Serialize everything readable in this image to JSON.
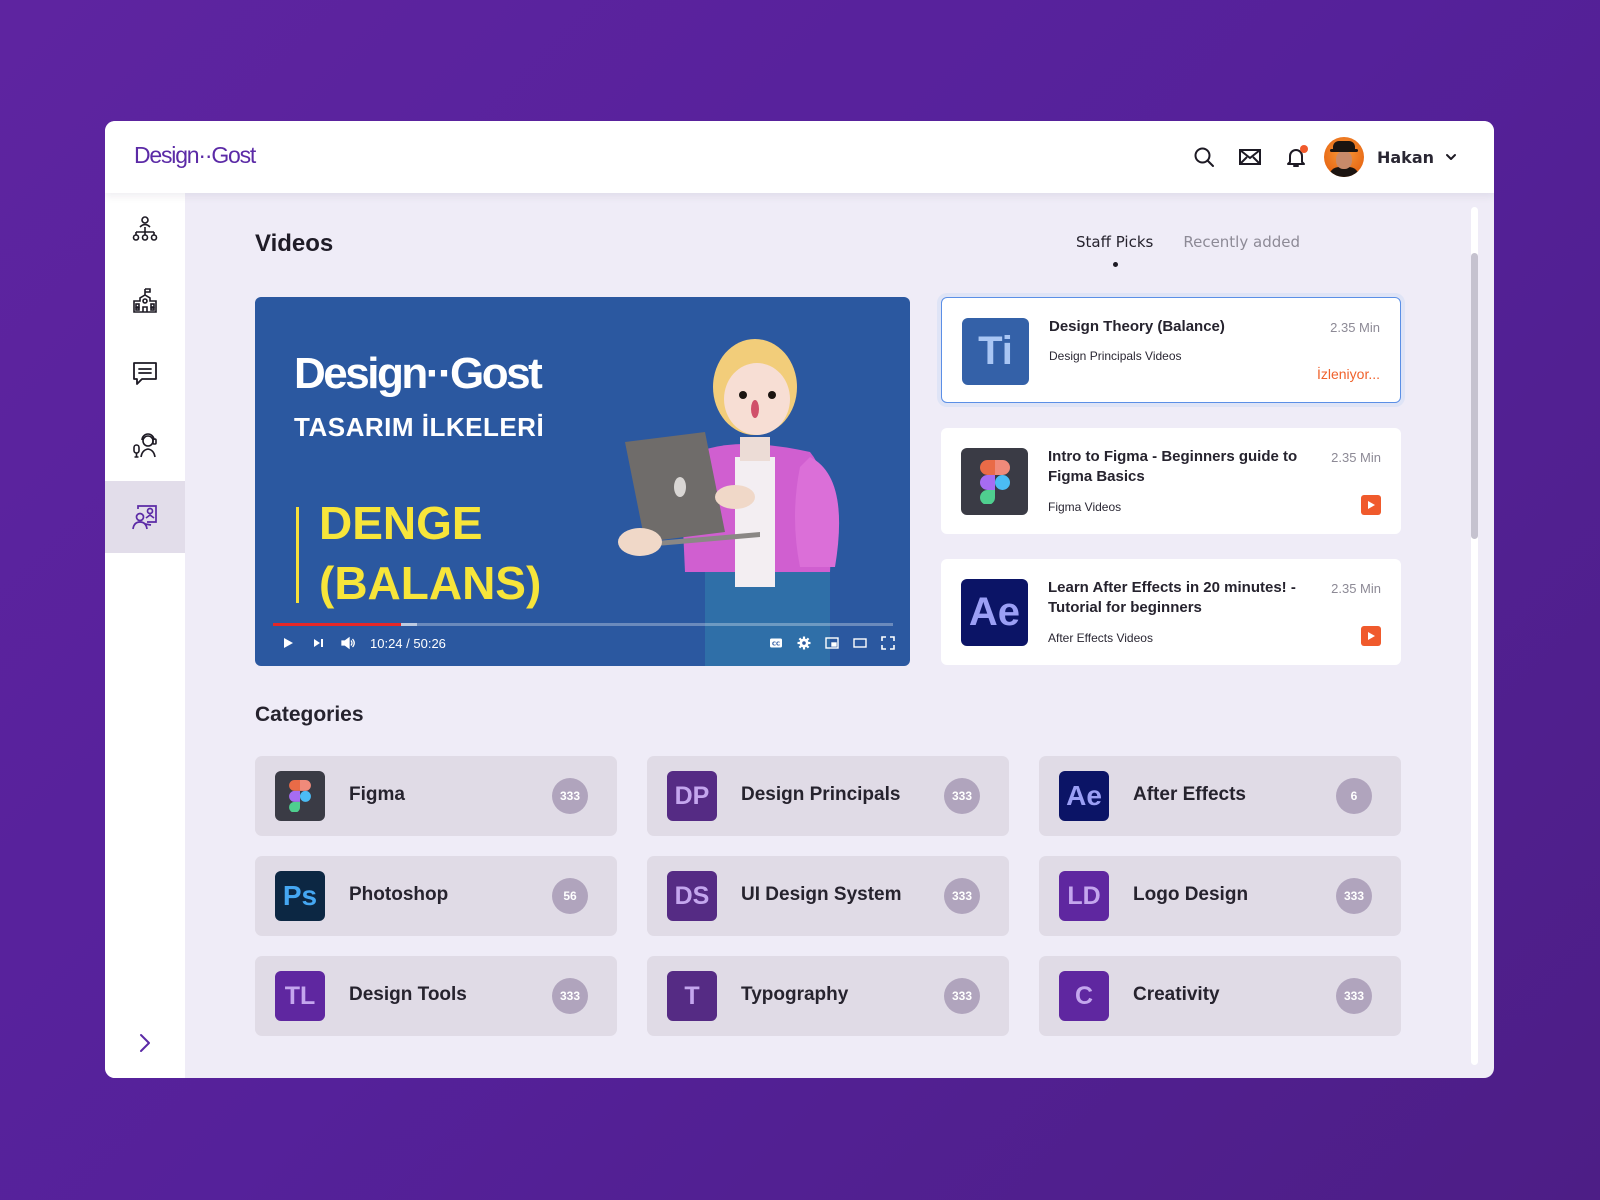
{
  "app": {
    "logo": "Design··Gost"
  },
  "header": {
    "icons": [
      "search-icon",
      "mail-icon",
      "bell-icon"
    ],
    "notification_dot_color": "#f05a2c",
    "user": {
      "name": "Hakan"
    }
  },
  "sidebar": {
    "items": [
      {
        "name": "organization",
        "icon": "org-chart-icon"
      },
      {
        "name": "school",
        "icon": "school-icon"
      },
      {
        "name": "messages",
        "icon": "chat-icon"
      },
      {
        "name": "support",
        "icon": "podcast-icon"
      },
      {
        "name": "presentation",
        "icon": "presentation-icon",
        "active": true
      }
    ],
    "expand_icon": "chevron-right-icon"
  },
  "main": {
    "title": "Videos",
    "tabs": [
      {
        "label": "Staff Picks",
        "active": true
      },
      {
        "label": "Recently added",
        "active": false
      }
    ],
    "player": {
      "brand": "Design··Gost",
      "subtitle": "TASARIM İLKELERİ",
      "headline_1": "DENGE",
      "headline_2": "(BALANS)",
      "current_time": "10:24",
      "duration": "50:26",
      "time_display": "10:24 / 50:26",
      "played_fraction": 0.207,
      "buffered_fraction": 0.233
    },
    "video_list": [
      {
        "thumb": "Ti",
        "thumb_bg": "#3461a8",
        "thumb_fg": "#a9c6f4",
        "title": "Design Theory (Balance)",
        "subtitle": "Design Principals Videos",
        "duration": "2.35 Min",
        "status": "İzleniyor...",
        "active": true
      },
      {
        "thumb": "figma",
        "thumb_bg": "#3a3b45",
        "title": "Intro to Figma - Beginners guide to Figma Basics",
        "subtitle": "Figma Videos",
        "duration": "2.35 Min",
        "active": false
      },
      {
        "thumb": "Ae",
        "thumb_bg": "#0b1466",
        "thumb_fg": "#9b9ff5",
        "title": "Learn After Effects in 20 minutes! - Tutorial for beginners",
        "subtitle": "After Effects Videos",
        "duration": "2.35 Min",
        "active": false
      }
    ],
    "categories_title": "Categories",
    "categories": [
      {
        "icon": "figma",
        "bg": "#3a3b45",
        "fg": "#fff",
        "label": "Figma",
        "count": "333"
      },
      {
        "icon": "DP",
        "bg": "#552b84",
        "fg": "#c4a6ee",
        "label": "Design Principals",
        "count": "333"
      },
      {
        "icon": "Ae",
        "bg": "#0b1466",
        "fg": "#9b9ff5",
        "label": "After Effects",
        "count": "6"
      },
      {
        "icon": "Ps",
        "bg": "#0c2743",
        "fg": "#45a7f2",
        "label": "Photoshop",
        "count": "56"
      },
      {
        "icon": "DS",
        "bg": "#552b84",
        "fg": "#c4a6ee",
        "label": "UI Design System",
        "count": "333"
      },
      {
        "icon": "LD",
        "bg": "#5f27a0",
        "fg": "#c4a6ee",
        "label": "Logo Design",
        "count": "333"
      },
      {
        "icon": "TL",
        "bg": "#5f27a0",
        "fg": "#c4a6ee",
        "label": "Design Tools",
        "count": "333"
      },
      {
        "icon": "T",
        "bg": "#552b84",
        "fg": "#c4a6ee",
        "label": "Typography",
        "count": "333"
      },
      {
        "icon": "C",
        "bg": "#5f27a0",
        "fg": "#c4a6ee",
        "label": "Creativity",
        "count": "333"
      }
    ]
  }
}
